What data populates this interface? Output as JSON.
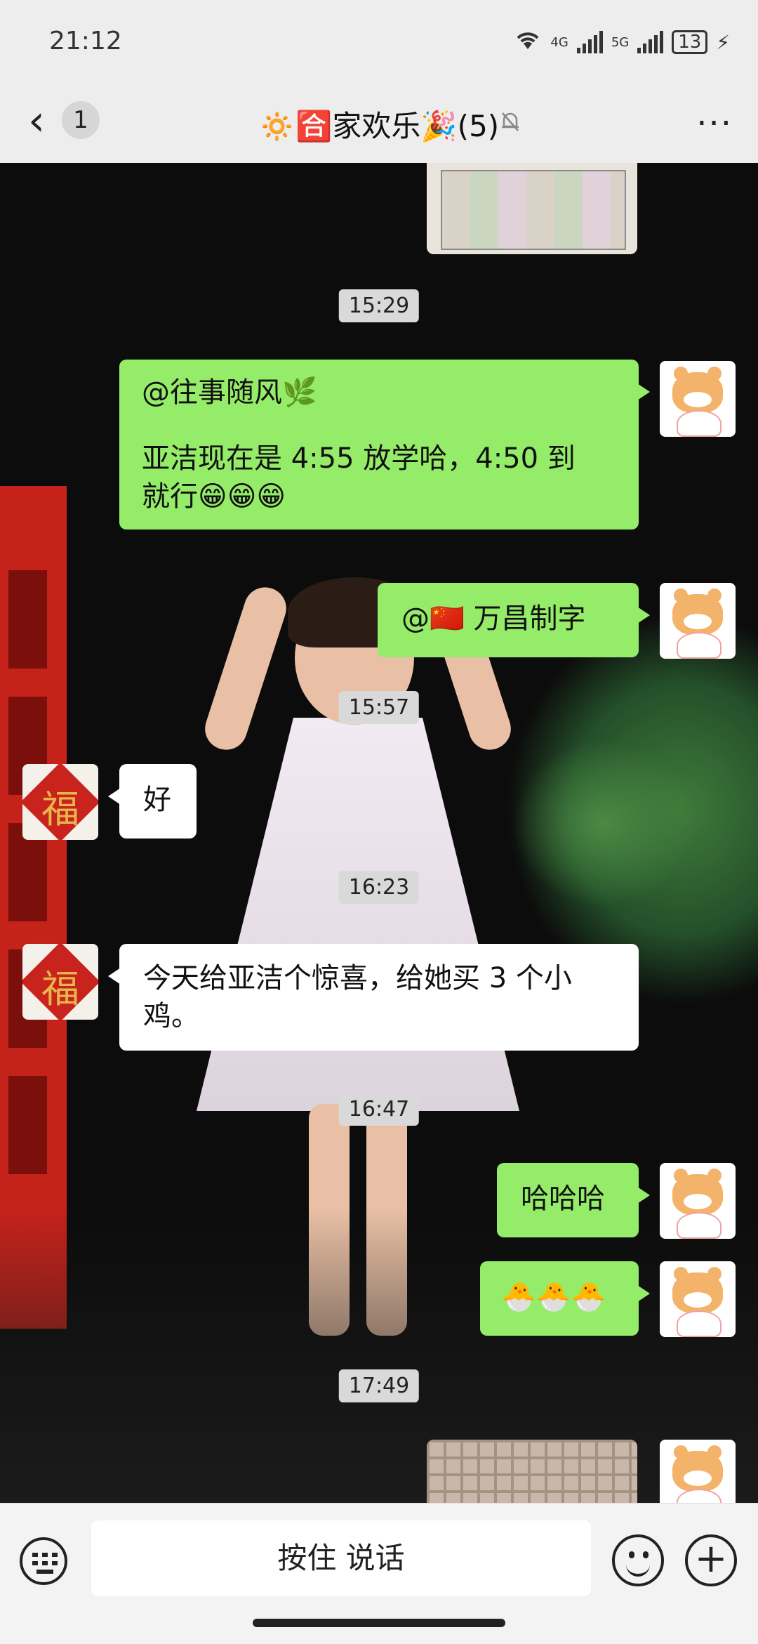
{
  "status_bar": {
    "time": "21:12",
    "network_1": "4G",
    "network_2": "5G",
    "battery": "13"
  },
  "header": {
    "back_count": "1",
    "title": "🔅🈴家欢乐🎉(5)"
  },
  "messages": [
    {
      "type": "timestamp",
      "text": "15:29"
    },
    {
      "type": "text",
      "from": "me",
      "lines": [
        "@往事随风🌿",
        "",
        "亚洁现在是 4:55 放学哈，4:50 到",
        "就行😁😁😁"
      ]
    },
    {
      "type": "text",
      "from": "me",
      "lines": [
        "@🇨🇳 万昌制字"
      ]
    },
    {
      "type": "timestamp",
      "text": "15:57"
    },
    {
      "type": "text",
      "from": "other",
      "lines": [
        "好"
      ]
    },
    {
      "type": "timestamp",
      "text": "16:23"
    },
    {
      "type": "text",
      "from": "other",
      "lines": [
        "今天给亚洁个惊喜，给她买 3 个小",
        "鸡。"
      ]
    },
    {
      "type": "timestamp",
      "text": "16:47"
    },
    {
      "type": "text",
      "from": "me",
      "lines": [
        "哈哈哈"
      ]
    },
    {
      "type": "text",
      "from": "me",
      "lines": [
        "🐣🐣🐣"
      ]
    },
    {
      "type": "timestamp",
      "text": "17:49"
    }
  ],
  "avatars": {
    "other_char": "福"
  },
  "input_bar": {
    "voice_label": "按住 说话"
  },
  "colors": {
    "bubble_me": "#95ec69",
    "bubble_other": "#ffffff",
    "header_bg": "#ededed"
  }
}
